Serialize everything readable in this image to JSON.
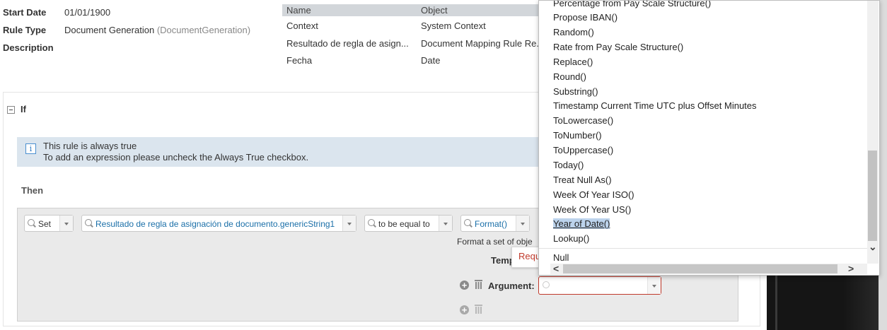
{
  "meta": {
    "start_date_label": "Start Date",
    "start_date_value": "01/01/1900",
    "rule_type_label": "Rule Type",
    "rule_type_value": "Document Generation",
    "rule_type_code": "(DocumentGeneration)",
    "description_label": "Description"
  },
  "variables": {
    "headers": [
      "Name",
      "Object"
    ],
    "rows": [
      {
        "name": "Context",
        "object": "System Context"
      },
      {
        "name": "Resultado de regla de asign...",
        "object": "Document Mapping Rule Re..."
      },
      {
        "name": "Fecha",
        "object": "Date"
      }
    ]
  },
  "if_section": {
    "title": "If",
    "info_icon": "i",
    "info_line1": "This rule is always true",
    "info_line2": "To add an expression please uncheck the Always True checkbox."
  },
  "then_section": {
    "title": "Then",
    "set_combo": "Set",
    "target_combo": "Resultado de regla de asignación de documento.genericString1",
    "operator_combo": "to be equal to",
    "function_combo": "Format()",
    "format_desc": "Format a set of obje",
    "template_label": "Temp",
    "tooltip_text": "Requ",
    "argument_label": "Argument:",
    "argument_value": "",
    "plus_icon": "+"
  },
  "dropdown": {
    "items": [
      "Percentage from Pay Scale Structure()",
      "Propose IBAN()",
      "Random()",
      "Rate from Pay Scale Structure()",
      "Replace()",
      "Round()",
      "Substring()",
      "Timestamp Current Time UTC plus Offset Minutes",
      "ToLowercase()",
      "ToNumber()",
      "ToUppercase()",
      "Today()",
      "Treat Null As()",
      "Week Of Year ISO()",
      "Week Of Year US()",
      "Year of Date()",
      "Lookup()"
    ],
    "selected_index": 15,
    "null_item": "Null",
    "scroll_left": "<",
    "scroll_right": ">",
    "scroll_down": "⌄"
  }
}
